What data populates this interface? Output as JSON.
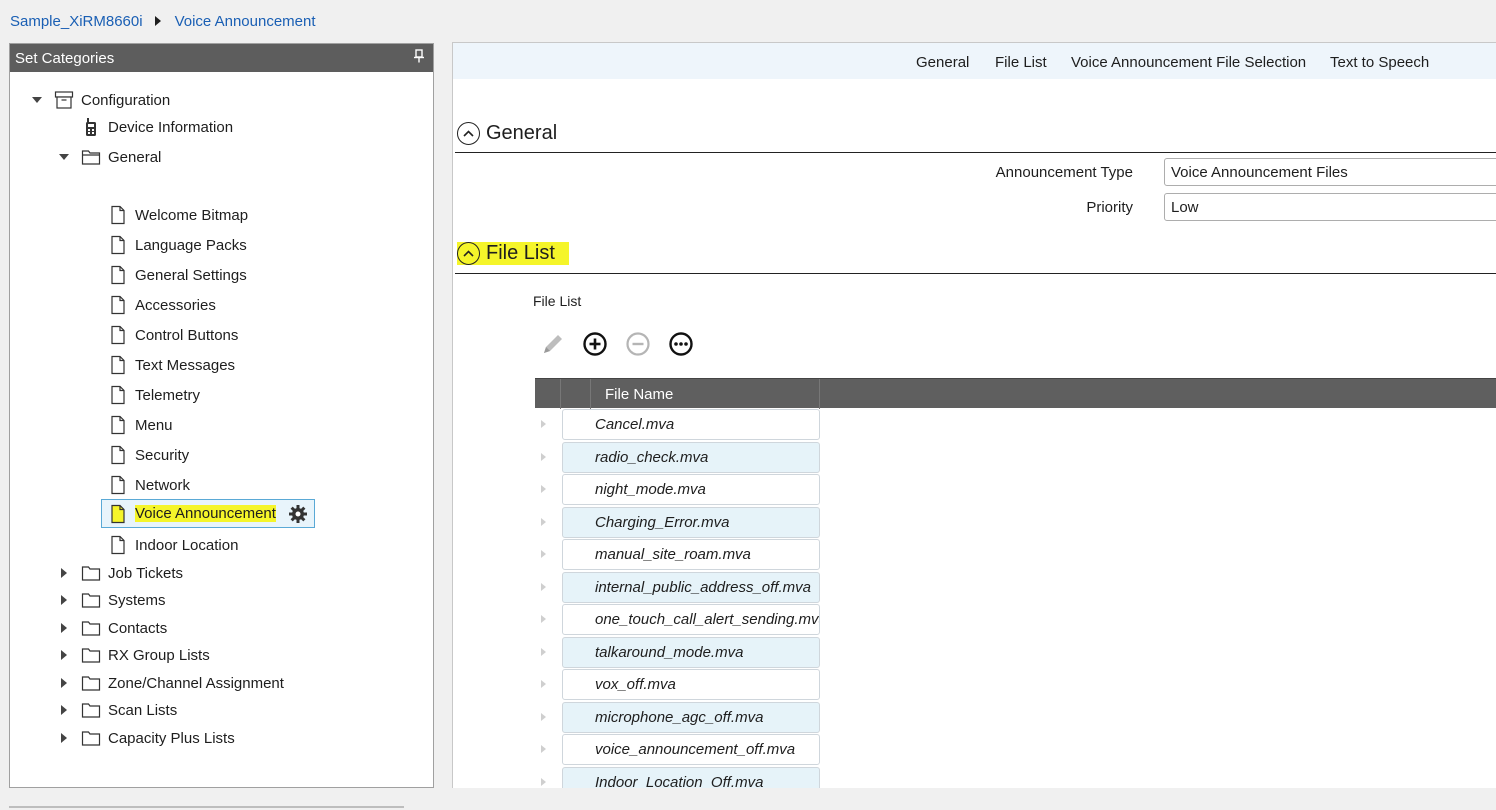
{
  "breadcrumb": {
    "items": [
      "Sample_XiRM8660i",
      "Voice Announcement"
    ]
  },
  "left_panel": {
    "title": "Set Categories",
    "tree": {
      "configuration": "Configuration",
      "device_information": "Device Information",
      "general": "General",
      "general_children": [
        "Welcome Bitmap",
        "Language Packs",
        "General Settings",
        "Accessories",
        "Control Buttons",
        "Text Messages",
        "Telemetry",
        "Menu",
        "Security",
        "Network"
      ],
      "selected": "Voice Announcement",
      "indoor_location": "Indoor Location",
      "collapsed_folders": [
        "Job Tickets",
        "Systems",
        "Contacts",
        "RX Group Lists",
        "Zone/Channel Assignment",
        "Scan Lists",
        "Capacity Plus Lists"
      ]
    }
  },
  "tabs": [
    "General",
    "File List",
    "Voice Announcement File Selection",
    "Text to Speech"
  ],
  "general_section": {
    "title": "General",
    "announcement_type_label": "Announcement Type",
    "announcement_type_value": "Voice Announcement Files",
    "priority_label": "Priority",
    "priority_value": "Low"
  },
  "file_list_section": {
    "title": "File List",
    "grid_label": "File List",
    "toolbar_icons": [
      "pencil-icon",
      "add-circle-icon",
      "remove-circle-icon",
      "more-circle-icon"
    ],
    "column_header": "File Name",
    "files": [
      "Cancel.mva",
      "radio_check.mva",
      "night_mode.mva",
      "Charging_Error.mva",
      "manual_site_roam.mva",
      "internal_public_address_off.mva",
      "one_touch_call_alert_sending.mva",
      "talkaround_mode.mva",
      "vox_off.mva",
      "microphone_agc_off.mva",
      "voice_announcement_off.mva",
      "Indoor_Location_Off.mva"
    ]
  },
  "colors": {
    "highlight": "#f5f52a",
    "link": "#1a5fb4",
    "header_bg": "#5d5d5d",
    "row_alt": "#e6f3f9",
    "tabs_bg": "#eef5fb"
  }
}
